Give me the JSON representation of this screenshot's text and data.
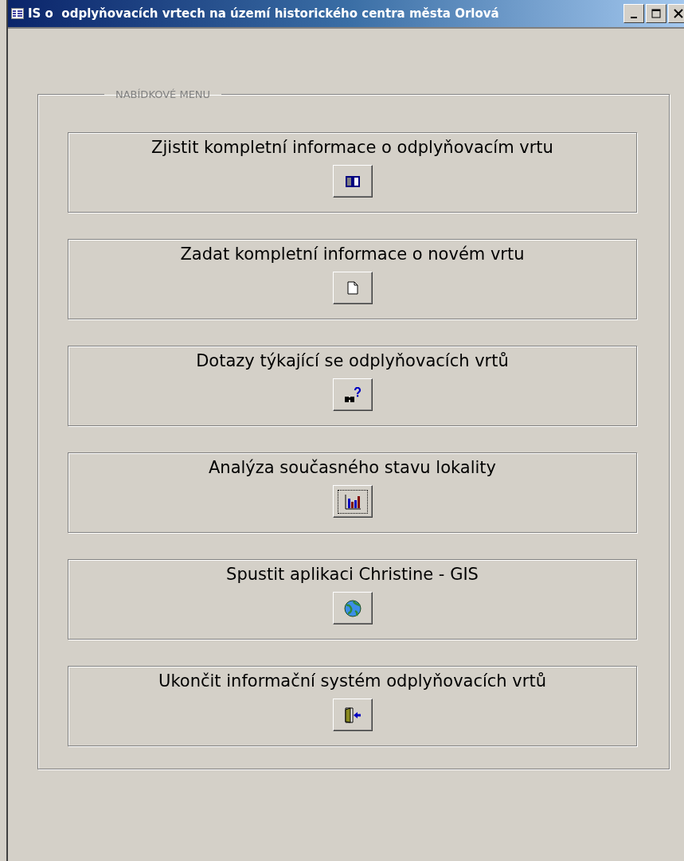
{
  "window": {
    "title": "IS o  odplyňovacích vrtech na území historického centra města Orlová"
  },
  "menu": {
    "legend": "NABÍDKOVÉ MENU",
    "items": [
      {
        "label": "Zjistit kompletní informace o odplyňovacím vrtu",
        "focused": false
      },
      {
        "label": "Zadat kompletní informace o novém vrtu",
        "focused": false
      },
      {
        "label": "Dotazy týkající se odplyňovacích vrtů",
        "focused": false
      },
      {
        "label": "Analýza současného stavu lokality",
        "focused": true
      },
      {
        "label": "Spustit aplikaci Christine - GIS",
        "focused": false
      },
      {
        "label": "Ukončit informační systém odplyňovacích vrtů",
        "focused": false
      }
    ]
  }
}
